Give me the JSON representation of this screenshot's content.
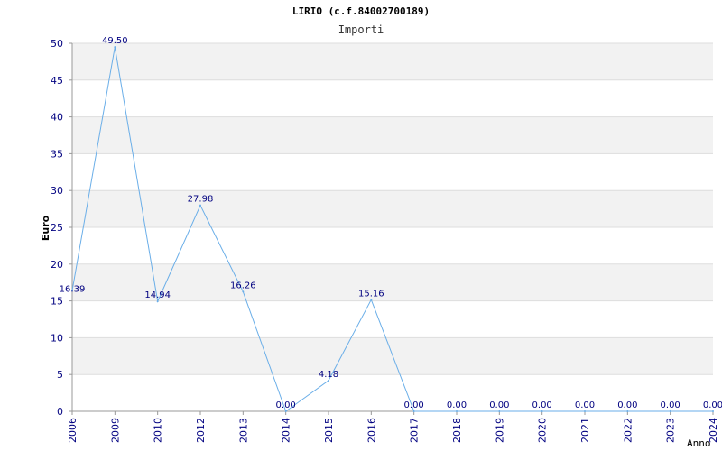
{
  "chart_data": {
    "type": "line",
    "title": "LIRIO (c.f.84002700189)",
    "subtitle": "Importi",
    "xlabel": "Anno",
    "ylabel": "Euro",
    "ylim": [
      0,
      50
    ],
    "yticks": [
      0,
      5,
      10,
      15,
      20,
      25,
      30,
      35,
      40,
      45,
      50
    ],
    "grid": true,
    "categories": [
      "2006",
      "2009",
      "2010",
      "2012",
      "2013",
      "2014",
      "2015",
      "2016",
      "2017",
      "2018",
      "2019",
      "2020",
      "2021",
      "2022",
      "2023",
      "2024"
    ],
    "values": [
      16.39,
      49.5,
      14.94,
      27.98,
      16.26,
      0.0,
      4.18,
      15.16,
      0.0,
      0.0,
      0.0,
      0.0,
      0.0,
      0.0,
      0.0,
      0.0
    ],
    "value_labels": [
      "16.39",
      "49.50",
      "14.94",
      "27.98",
      "16.26",
      "0.00",
      "4.18",
      "15.16",
      "0.00",
      "0.00",
      "0.00",
      "0.00",
      "0.00",
      "0.00",
      "0.00",
      "0.00"
    ],
    "colors": {
      "line": "#6aaee8",
      "band": "#f2f2f2",
      "grid": "#dddddd",
      "text": "#000080"
    }
  }
}
